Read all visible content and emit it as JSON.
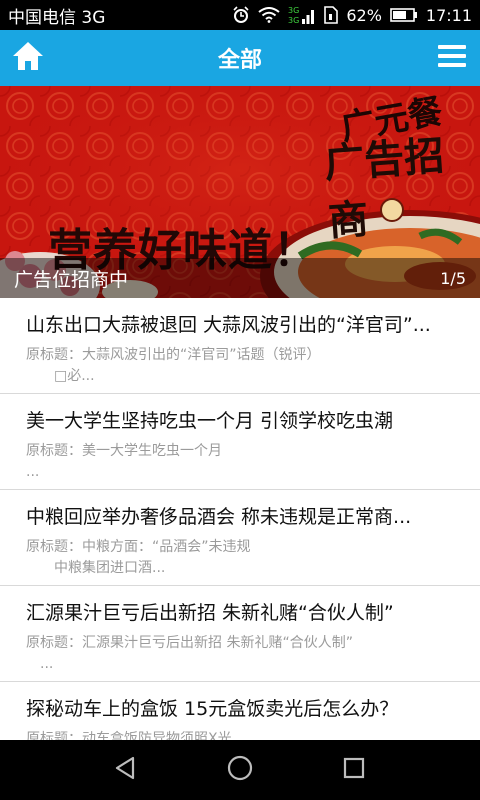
{
  "status_bar": {
    "carrier": "中国电信 3G",
    "battery": "62%",
    "time": "17:11",
    "icons": [
      "alarm-icon",
      "wifi-icon",
      "signal-icon",
      "sim-icon",
      "battery-icon"
    ]
  },
  "header": {
    "title": "全部",
    "left_icon": "home-icon",
    "right_icon": "menu-icon"
  },
  "banner": {
    "slogan": "营养好味道！",
    "slogan_right": "广元餐",
    "slogan_right_2": "广告招商",
    "caption": "广告位招商中",
    "pager": "1/5"
  },
  "news": [
    {
      "title": "山东出口大蒜被退回 大蒜风波引出的“洋官司”...",
      "summary": "原标题：大蒜风波引出的“洋官司”话题（锐评）",
      "summary2": "□必..."
    },
    {
      "title": "美一大学生坚持吃虫一个月 引领学校吃虫潮",
      "summary": "原标题：美一大学生吃虫一个月",
      "summary2": "..."
    },
    {
      "title": "中粮回应举办奢侈品酒会 称未违规是正常商...",
      "summary": "原标题：中粮方面：“品酒会”未违规",
      "summary2": "中粮集团进口酒..."
    },
    {
      "title": "汇源果汁巨亏后出新招 朱新礼赌“合伙人制”",
      "summary": "原标题：汇源果汁巨亏后出新招 朱新礼赌“合伙人制”",
      "summary2": "..."
    },
    {
      "title": "探秘动车上的盒饭 15元盒饭卖光后怎么办？",
      "summary": "原标题：动车盒饭防异物须照X光",
      "summary2": ""
    }
  ],
  "nav_bar": {
    "icons": [
      "back-icon",
      "home-circle-icon",
      "recents-icon"
    ]
  },
  "colors": {
    "header_bg": "#1aa6e2",
    "banner_red": "#c3150f",
    "text_dark": "#111111",
    "text_muted": "#9b9b9b"
  }
}
